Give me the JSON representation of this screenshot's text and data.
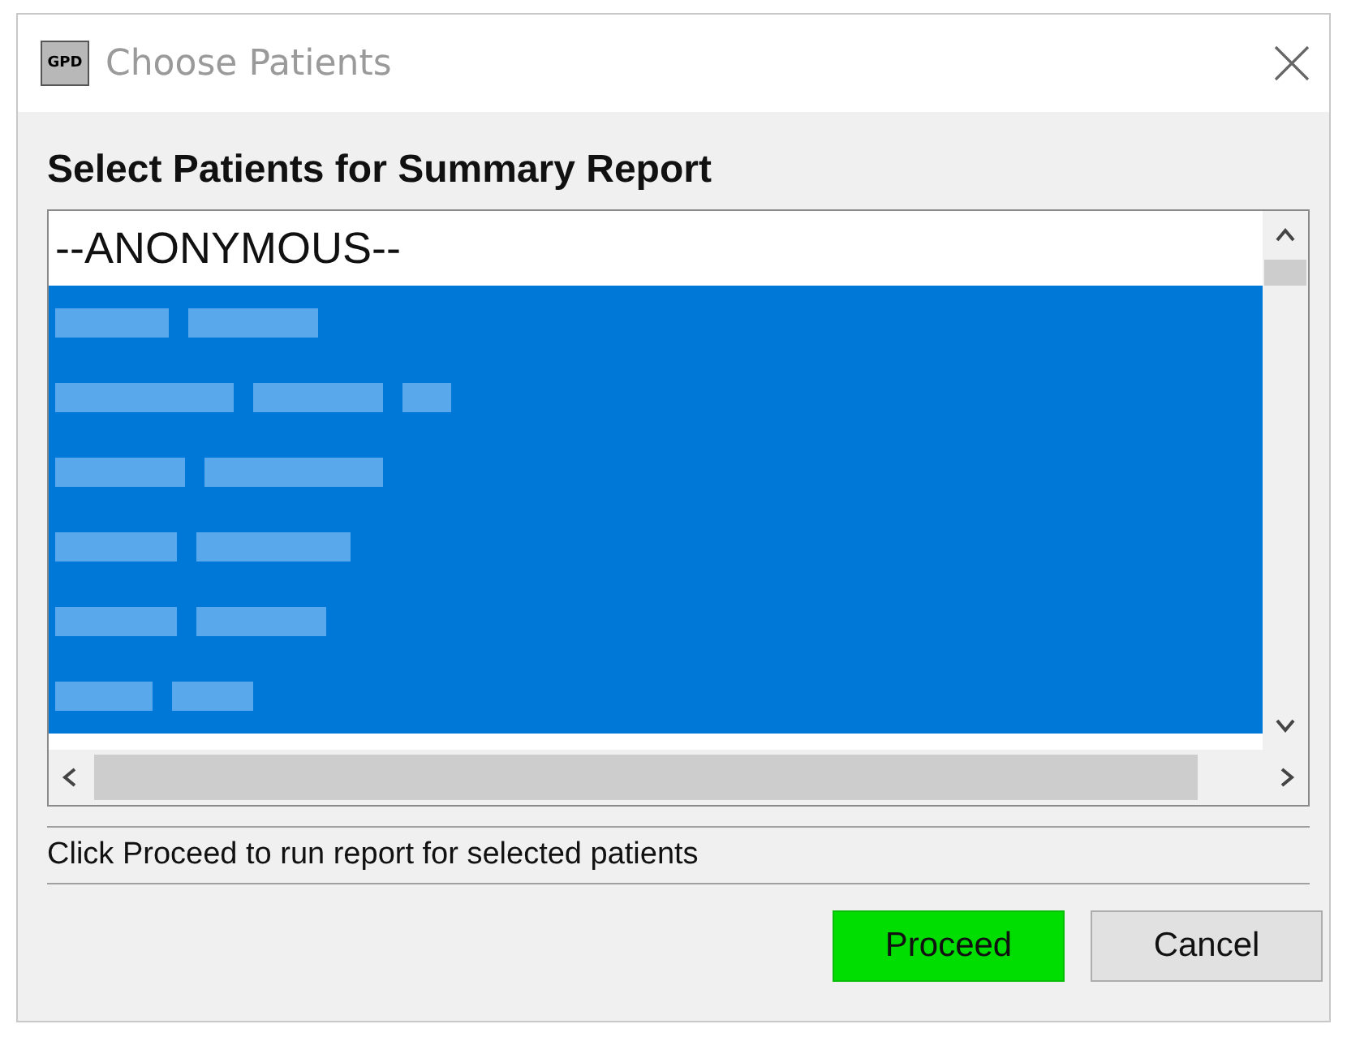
{
  "window": {
    "app_icon": "GPD",
    "title": "Choose Patients"
  },
  "heading": "Select Patients for Summary Report",
  "patients": [
    {
      "kind": "text",
      "label": "--ANONYMOUS--",
      "selected": false
    },
    {
      "kind": "redacted",
      "selected": true
    },
    {
      "kind": "redacted",
      "selected": true
    },
    {
      "kind": "redacted",
      "selected": true
    },
    {
      "kind": "redacted",
      "selected": true
    },
    {
      "kind": "redacted",
      "selected": true
    },
    {
      "kind": "redacted",
      "selected": true
    }
  ],
  "status": "Click Proceed to run report for selected patients",
  "buttons": [
    {
      "label": "Proceed",
      "kind": "primary"
    },
    {
      "label": "Cancel",
      "kind": "secondary"
    }
  ]
}
